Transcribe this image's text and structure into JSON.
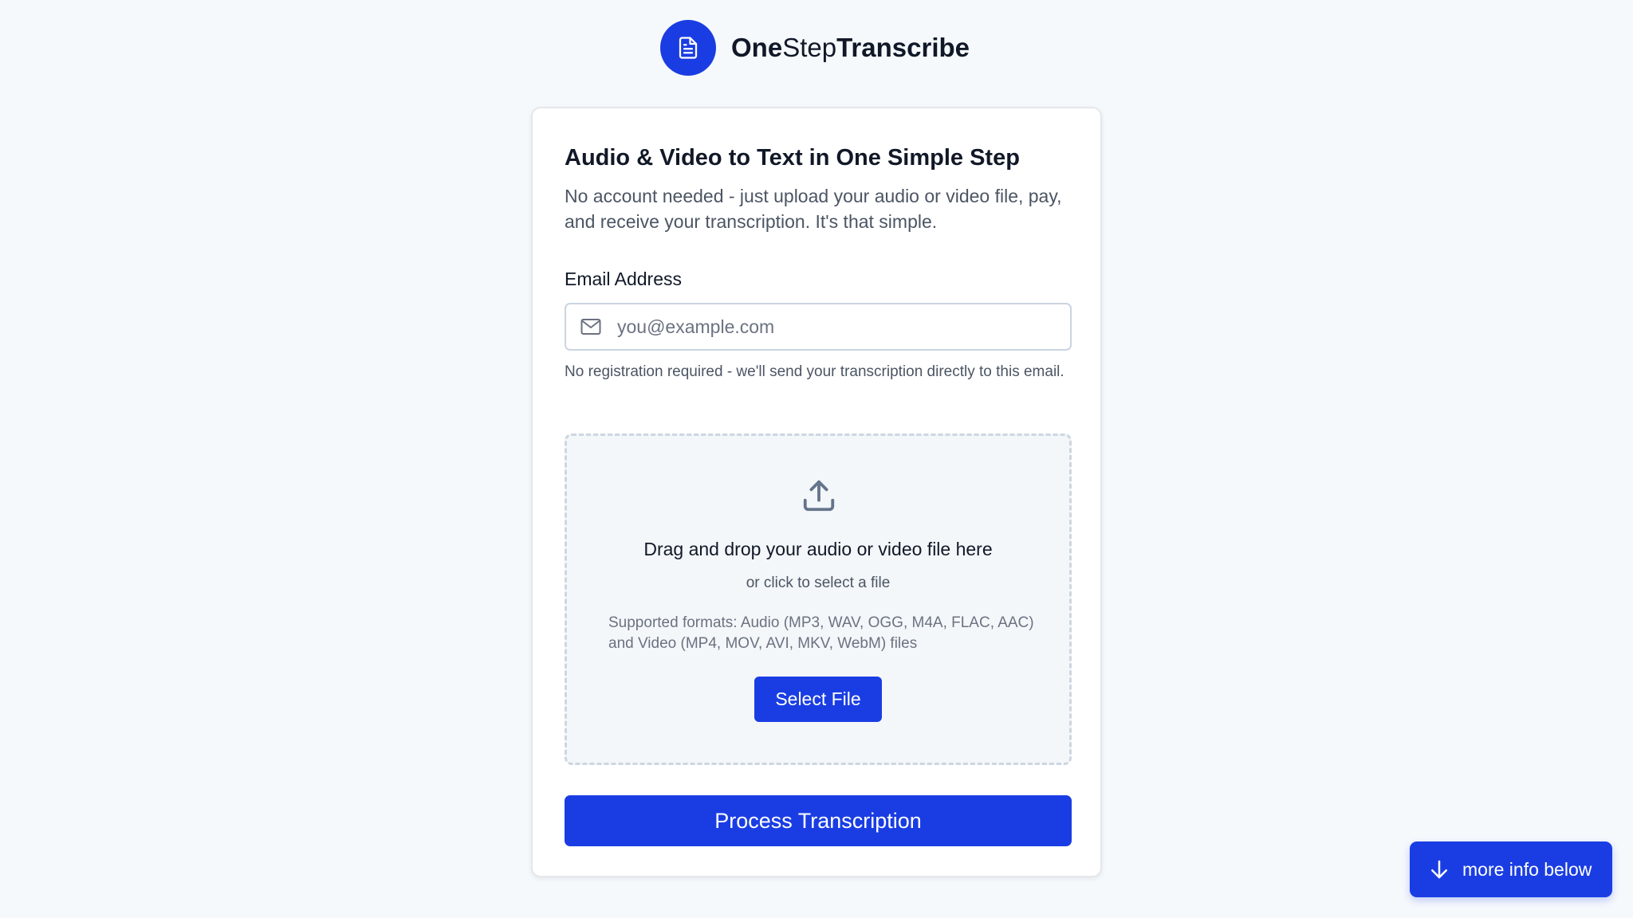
{
  "brand": {
    "part1": "One",
    "part2": "Step",
    "part3": "Transcribe"
  },
  "card": {
    "title": "Audio & Video to Text in One Simple Step",
    "description": "No account needed - just upload your audio or video file, pay, and receive your transcription. It's that simple."
  },
  "email": {
    "label": "Email Address",
    "placeholder": "you@example.com",
    "value": "",
    "help": "No registration required - we'll send your transcription directly to this email."
  },
  "dropzone": {
    "title": "Drag and drop your audio or video file here",
    "subtitle": "or click to select a file",
    "formats": "Supported formats: Audio (MP3, WAV, OGG, M4A, FLAC, AAC) and Video (MP4, MOV, AVI, MKV, WebM) files",
    "button_label": "Select File"
  },
  "process_button": "Process Transcription",
  "more_info_button": "more info below",
  "colors": {
    "accent": "#1a3de3",
    "background": "#f6f9fc"
  },
  "icons": {
    "logo": "document-icon",
    "email": "mail-icon",
    "upload": "upload-icon",
    "more_info": "arrow-down-icon"
  }
}
